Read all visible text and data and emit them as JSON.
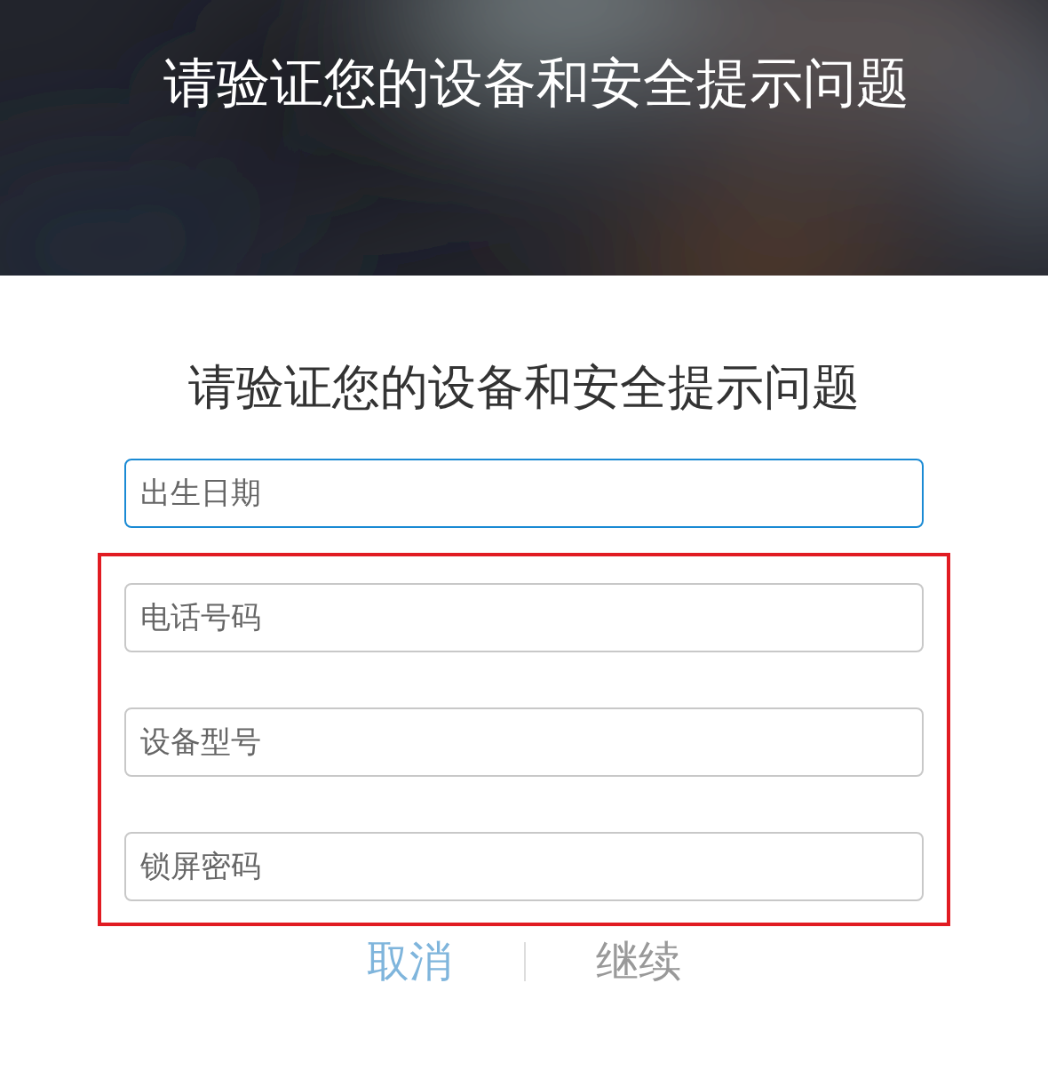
{
  "header": {
    "kind": "picture",
    "title": "请验证您的设备和安全提示问题"
  },
  "form": {
    "title": "请验证您的设备和安全提示问题",
    "fields": [
      {
        "placeholder": "出生日期",
        "focused": true
      }
    ],
    "highlighted_fields": [
      {
        "placeholder": "电话号码",
        "focused": false
      },
      {
        "placeholder": "设备型号",
        "focused": false
      },
      {
        "placeholder": "锁屏密码",
        "focused": false
      }
    ],
    "buttons": [
      {
        "label": "取消",
        "kind": "cancel"
      },
      {
        "label": "继续",
        "kind": "continue"
      }
    ]
  }
}
